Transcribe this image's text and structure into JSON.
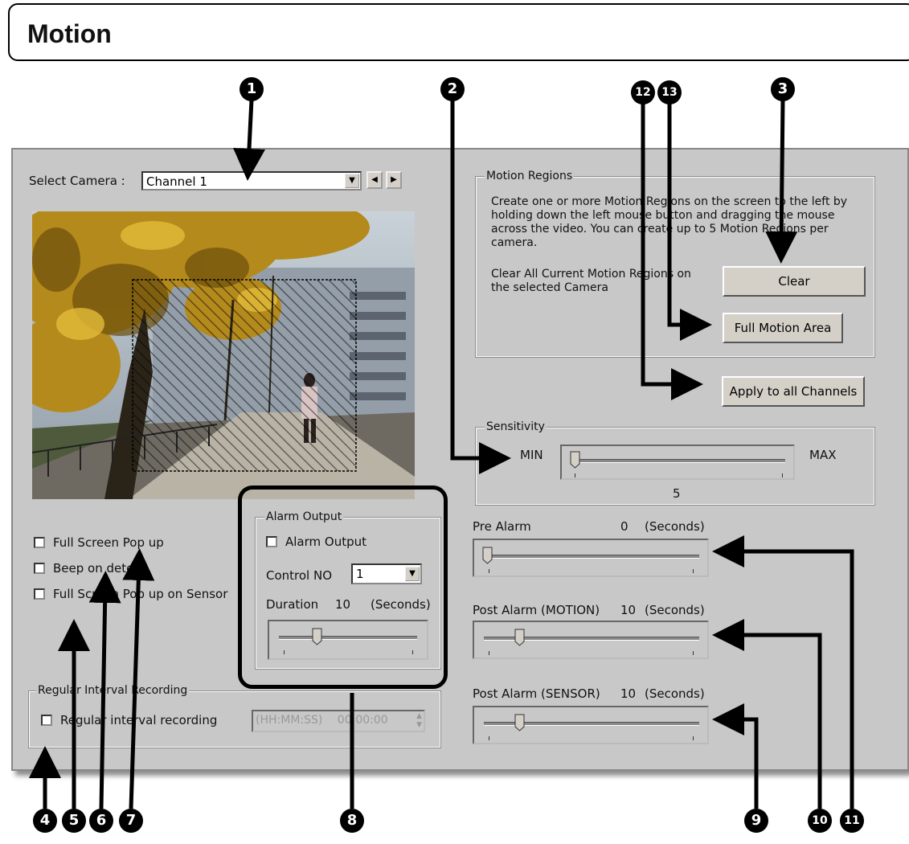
{
  "page": {
    "title": "Motion"
  },
  "camera": {
    "select_label": "Select Camera :",
    "selected": "Channel 1",
    "prev_icon": "left-arrow-icon",
    "next_icon": "right-arrow-icon"
  },
  "motion_regions": {
    "legend": "Motion Regions",
    "description": "Create one or more Motion Regions on the screen to the left by holding down the left mouse button and dragging the mouse across the video. You can create up to 5 Motion Regions per camera.",
    "clear_text": "Clear All Current Motion Regions on the selected Camera",
    "clear_label": "Clear",
    "full_motion_label": "Full Motion Area"
  },
  "apply_label": "Apply to all Channels",
  "sensitivity": {
    "legend": "Sensitivity",
    "min_label": "MIN",
    "max_label": "MAX",
    "value": "5"
  },
  "options": {
    "full_screen_popup": "Full Screen Pop up",
    "beep_on_detect": "Beep on detect",
    "full_screen_popup_sensor": "Full Screen Pop up on Sensor"
  },
  "alarm_output": {
    "legend": "Alarm Output",
    "checkbox_label": "Alarm Output",
    "control_no_label": "Control NO",
    "control_no_value": "1",
    "duration_label": "Duration",
    "duration_value": "10",
    "duration_unit": "(Seconds)",
    "slider_fraction": 0.25
  },
  "pre_alarm": {
    "label": "Pre Alarm",
    "value": "0",
    "unit": "(Seconds)",
    "slider_fraction": 0.0
  },
  "post_alarm_motion": {
    "label": "Post Alarm (MOTION)",
    "value": "10",
    "unit": "(Seconds)",
    "slider_fraction": 0.15
  },
  "post_alarm_sensor": {
    "label": "Post Alarm (SENSOR)",
    "value": "10",
    "unit": "(Seconds)",
    "slider_fraction": 0.15
  },
  "regular_interval": {
    "legend": "Regular Interval Recording",
    "checkbox_label": "Regular interval recording",
    "time_format": "(HH:MM:SS)",
    "time_value": "00:00:00"
  },
  "callouts": [
    "1",
    "2",
    "3",
    "4",
    "5",
    "6",
    "7",
    "8",
    "9",
    "10",
    "11",
    "12",
    "13"
  ]
}
